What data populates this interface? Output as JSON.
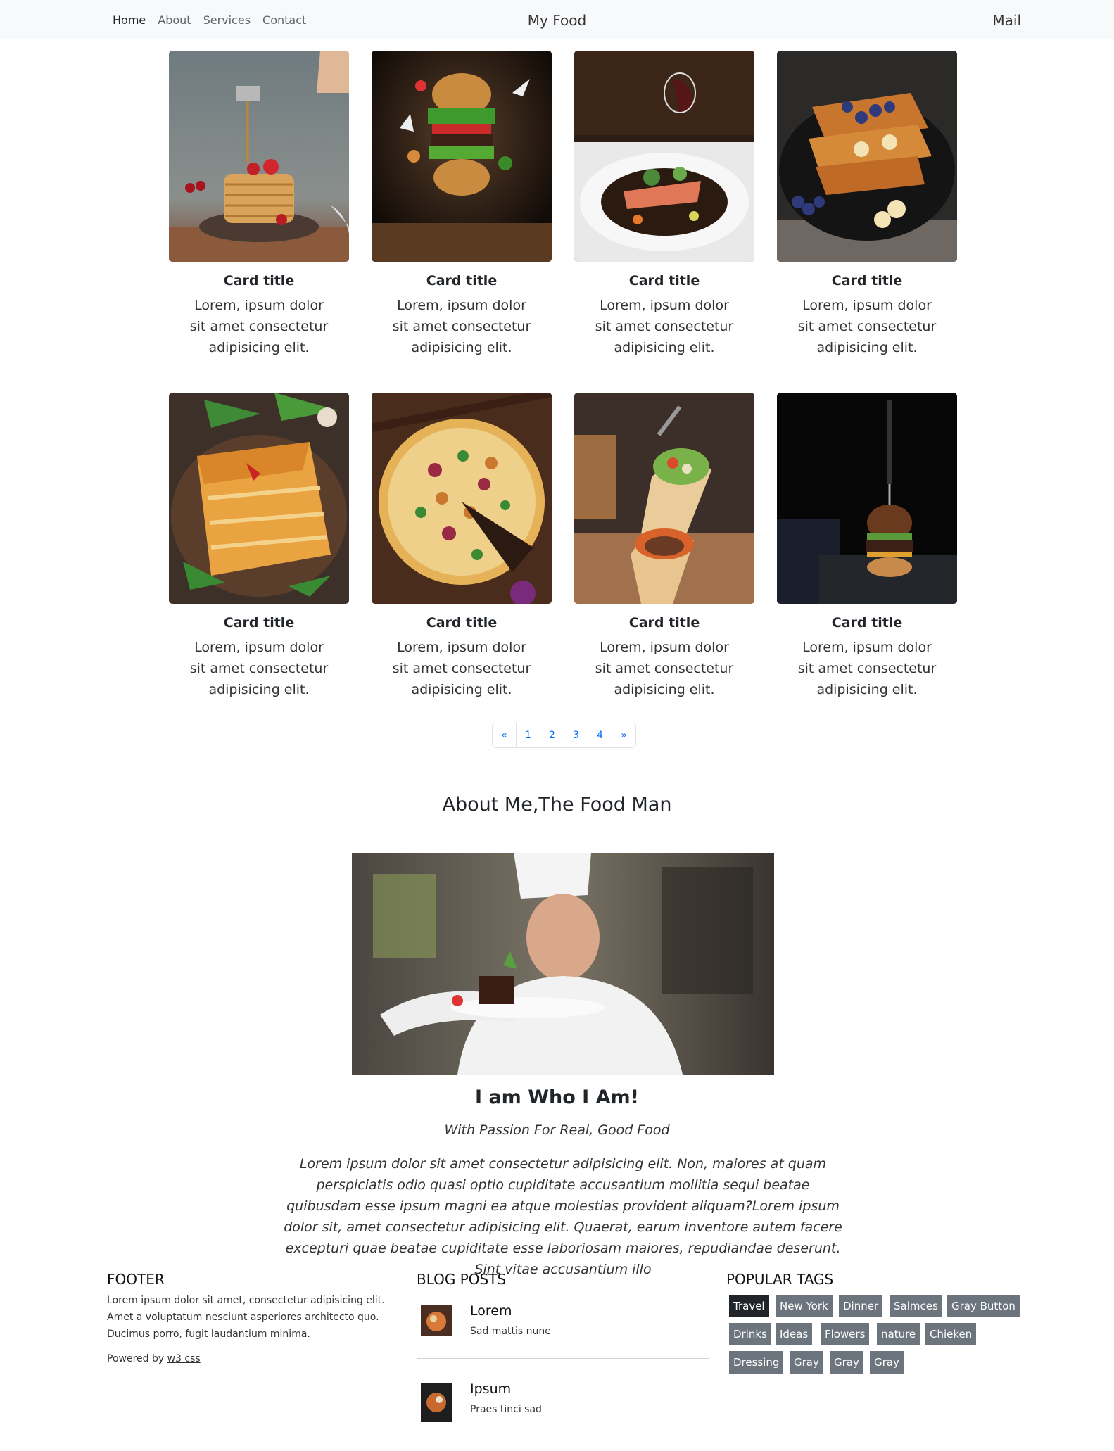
{
  "nav": {
    "links": [
      "Home",
      "About",
      "Services",
      "Contact"
    ],
    "brand": "My Food",
    "mail": "Mail"
  },
  "cards": [
    {
      "title": "Card title",
      "text": "Lorem, ipsum dolor sit amet consectetur adipisicing elit.",
      "image": "pancakes with berries"
    },
    {
      "title": "Card title",
      "text": "Lorem, ipsum dolor sit amet consectetur adipisicing elit.",
      "image": "flying burger"
    },
    {
      "title": "Card title",
      "text": "Lorem, ipsum dolor sit amet consectetur adipisicing elit.",
      "image": "salmon dish"
    },
    {
      "title": "Card title",
      "text": "Lorem, ipsum dolor sit amet consectetur adipisicing elit.",
      "image": "french toast with blueberries and banana"
    },
    {
      "title": "Card title",
      "text": "Lorem, ipsum dolor sit amet consectetur adipisicing elit.",
      "image": "lasagna"
    },
    {
      "title": "Card title",
      "text": "Lorem, ipsum dolor sit amet consectetur adipisicing elit.",
      "image": "pizza"
    },
    {
      "title": "Card title",
      "text": "Lorem, ipsum dolor sit amet consectetur adipisicing elit.",
      "image": "burrito wraps"
    },
    {
      "title": "Card title",
      "text": "Lorem, ipsum dolor sit amet consectetur adipisicing elit.",
      "image": "mini burger with knife"
    }
  ],
  "pagination": {
    "prev": "«",
    "pages": [
      "1",
      "2",
      "3",
      "4"
    ],
    "next": "»"
  },
  "about": {
    "heading": "About Me,The Food Man",
    "image": "chef plating dessert",
    "title": "I am Who I Am!",
    "tagline": "With Passion For Real, Good Food",
    "paragraph": "Lorem ipsum dolor sit amet consectetur adipisicing elit. Non, maiores at quam perspiciatis odio quasi optio cupiditate accusantium mollitia sequi beatae quibusdam esse ipsum magni ea atque molestias provident aliquam?Lorem ipsum dolor sit, amet consectetur adipisicing elit. Quaerat, earum inventore autem facere excepturi quae beatae cupiditate esse laboriosam maiores, repudiandae deserunt. Sint vitae accusantium illo"
  },
  "footer": {
    "heading": "FOOTER",
    "text": "Lorem ipsum dolor sit amet, consectetur adipisicing elit. Amet a voluptatum nesciunt asperiores architecto quo. Ducimus porro, fugit laudantium minima.",
    "powered_prefix": "Powered by ",
    "powered_link": "w3 css"
  },
  "blog": {
    "heading": "BLOG POSTS",
    "posts": [
      {
        "title": "Lorem",
        "subtitle": "Sad mattis nune"
      },
      {
        "title": "Ipsum",
        "subtitle": "Praes tinci sad"
      }
    ]
  },
  "tags": {
    "heading": "POPULAR TAGS",
    "items": [
      "Travel",
      "New York",
      "Dinner",
      "Salmces",
      "Gray Button",
      "Drinks",
      "Ideas",
      "Flowers",
      "nature",
      "Chieken",
      "Dressing",
      "Gray",
      "Gray",
      "Gray"
    ],
    "colors": {
      "active": "#212529",
      "default": "#6c757d"
    }
  }
}
